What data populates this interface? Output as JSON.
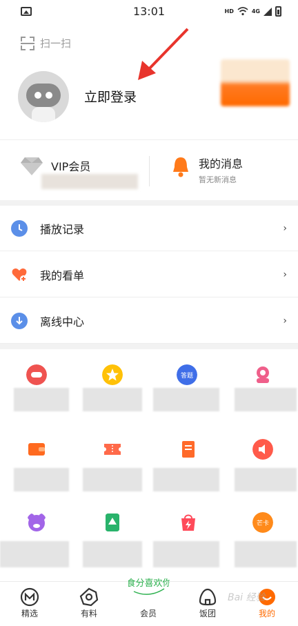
{
  "status_bar": {
    "time": "13:01",
    "network": "HD",
    "signal": "4G"
  },
  "header": {
    "scan_label": "扫一扫",
    "login_label": "立即登录"
  },
  "quick": {
    "vip_label": "VIP会员",
    "message_title": "我的消息",
    "message_subtitle": "暂无新消息"
  },
  "menu": [
    {
      "label": "播放记录",
      "chevron": "›",
      "icon": "clock-icon",
      "color": "#5b8fe8"
    },
    {
      "label": "我的看单",
      "chevron": "›",
      "icon": "heart-plus-icon",
      "color": "#ff6a3a"
    },
    {
      "label": "离线中心",
      "chevron": "›",
      "icon": "download-icon",
      "color": "#5b8fe8"
    }
  ],
  "grid_badges": {
    "quiz": "答题",
    "card": "芒卡"
  },
  "tabbar": {
    "items": [
      {
        "label": "精选",
        "icon": "home-m-icon"
      },
      {
        "label": "有料",
        "icon": "eye-ring-icon"
      },
      {
        "label": "会员",
        "icon": "member-logo-icon"
      },
      {
        "label": "饭团",
        "icon": "rice-ball-icon"
      },
      {
        "label": "我的",
        "icon": "profile-smile-icon",
        "active": true
      }
    ],
    "member_logo_text": "食分喜欢你"
  },
  "watermark": "Bai 经验",
  "colors": {
    "accent": "#ff6a00",
    "blue": "#5b8fe8",
    "divider": "#eeeeee"
  }
}
